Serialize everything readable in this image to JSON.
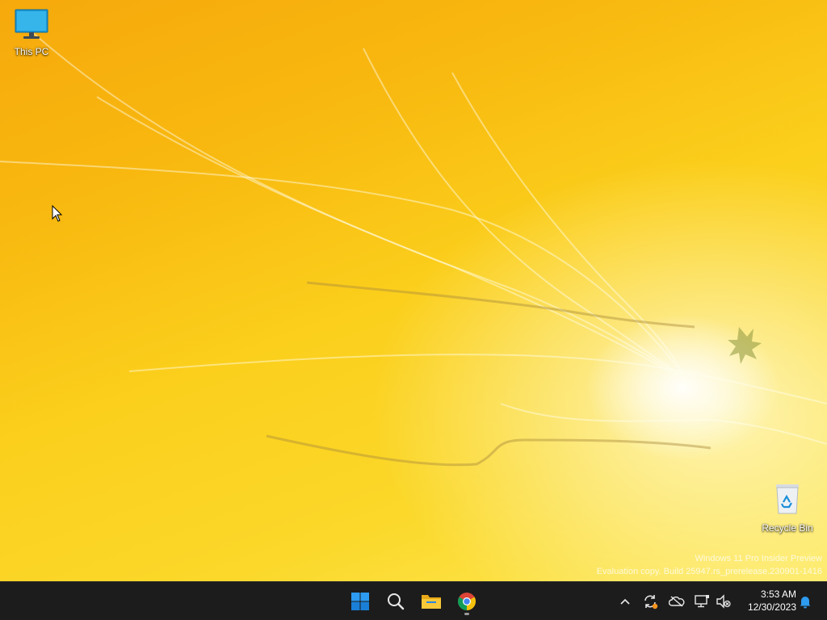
{
  "desktop": {
    "icons": [
      {
        "label": "This PC"
      },
      {
        "label": "Recycle Bin"
      }
    ],
    "watermark": {
      "line1": "Windows 11 Pro Insider Preview",
      "line2": "Evaluation copy. Build 25947.rs_prerelease.230901-1416"
    }
  },
  "taskbar": {
    "pinned": [
      {
        "name": "start",
        "icon": "windows-logo-icon"
      },
      {
        "name": "search",
        "icon": "search-icon"
      },
      {
        "name": "file-explorer",
        "icon": "folder-icon"
      },
      {
        "name": "chrome",
        "icon": "chrome-icon",
        "running": true
      }
    ],
    "tray": {
      "icons": [
        "chevron-up-icon",
        "update-icon",
        "onedrive-icon",
        "network-icon",
        "volume-muted-icon",
        "bell-icon"
      ],
      "time": "3:53 AM",
      "date": "12/30/2023"
    }
  },
  "colors": {
    "wallpaper_primary": "#f8b80f",
    "wallpaper_secondary": "#fde85a",
    "taskbar_bg": "#1c1c1c",
    "accent_blue": "#0078d4"
  }
}
